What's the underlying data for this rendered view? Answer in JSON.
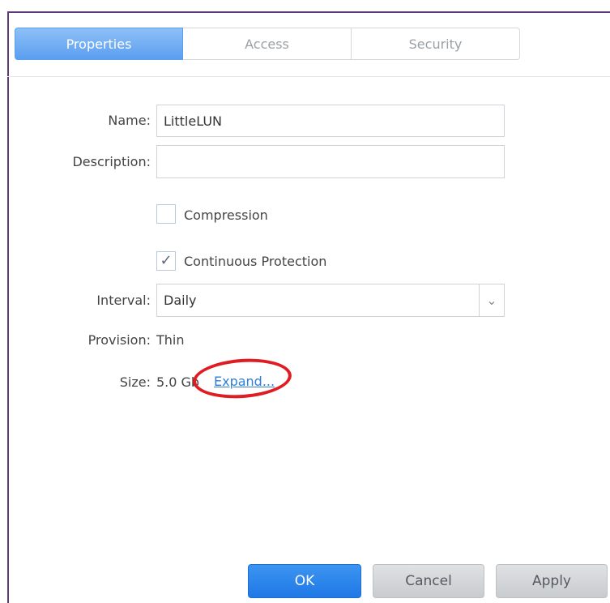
{
  "tabs": [
    {
      "label": "Properties",
      "active": true
    },
    {
      "label": "Access",
      "active": false
    },
    {
      "label": "Security",
      "active": false
    }
  ],
  "form": {
    "name_label": "Name:",
    "name_value": "LittleLUN",
    "description_label": "Description:",
    "description_value": "",
    "compression_label": "Compression",
    "compression_checked": false,
    "continuous_label": "Continuous Protection",
    "continuous_checked": true,
    "check_glyph": "✓",
    "interval_label": "Interval:",
    "interval_value": "Daily",
    "dropdown_glyph": "⌄",
    "provision_label": "Provision:",
    "provision_value": "Thin",
    "size_label": "Size:",
    "size_value": "5.0 Gb",
    "expand_link": "Expand..."
  },
  "buttons": {
    "ok": "OK",
    "cancel": "Cancel",
    "apply": "Apply"
  },
  "colors": {
    "tab_active": "#5b9ef0",
    "primary_button": "#1f78e6",
    "link": "#2f7fd6",
    "highlight_circle": "#e01b22",
    "frame": "#5b3a78"
  }
}
